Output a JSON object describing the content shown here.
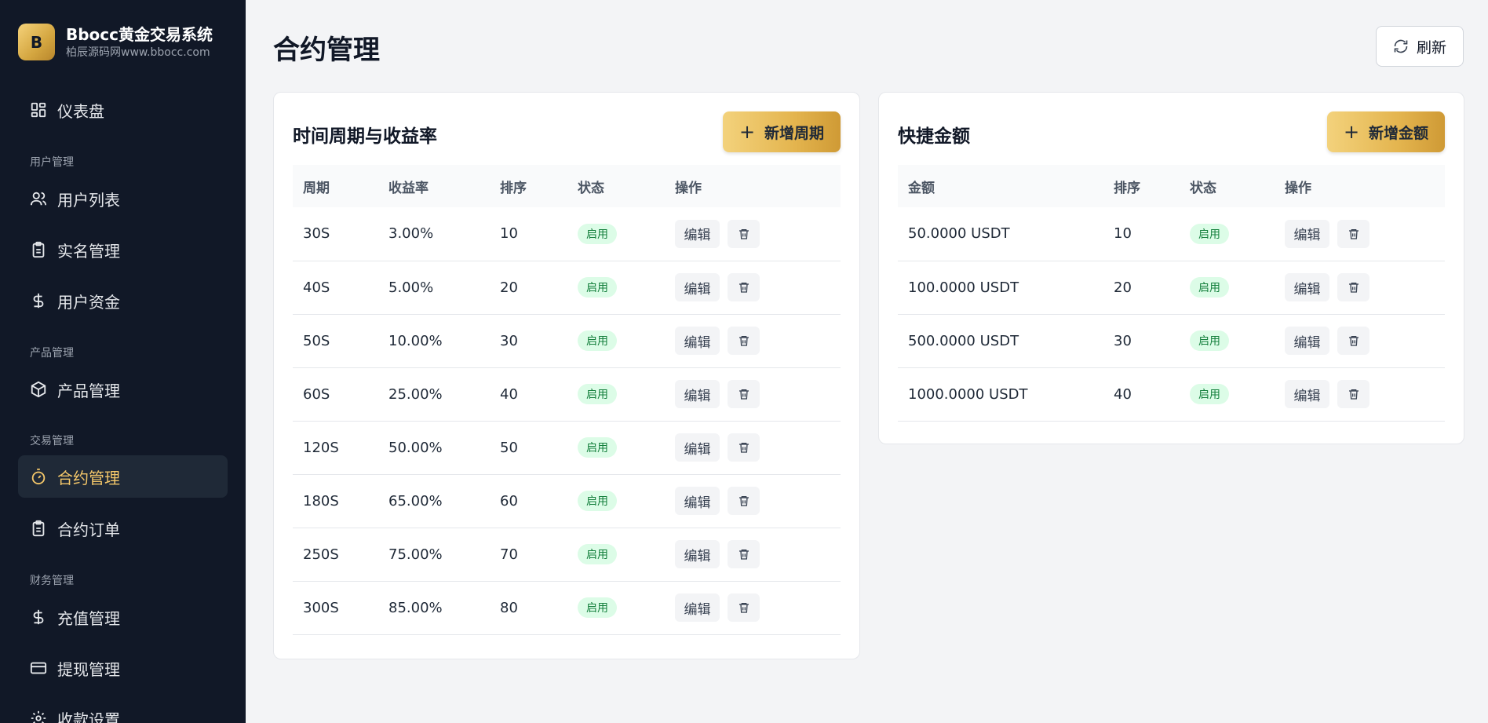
{
  "brand": {
    "logo_letter": "B",
    "title": "Bbocc黄金交易系统",
    "subtitle": "柏辰源码网www.bbocc.com"
  },
  "sidebar": {
    "items": [
      {
        "label": "仪表盘",
        "icon": "dashboard-icon"
      },
      {
        "label": "用户列表",
        "icon": "users-icon"
      },
      {
        "label": "实名管理",
        "icon": "clipboard-icon"
      },
      {
        "label": "用户资金",
        "icon": "dollar-icon"
      },
      {
        "label": "产品管理",
        "icon": "box-icon"
      },
      {
        "label": "合约管理",
        "icon": "timer-icon",
        "active": true
      },
      {
        "label": "合约订单",
        "icon": "clipboard-icon"
      },
      {
        "label": "充值管理",
        "icon": "dollar-icon"
      },
      {
        "label": "提现管理",
        "icon": "card-icon"
      },
      {
        "label": "收款设置",
        "icon": "gear-icon"
      }
    ],
    "sections": [
      "用户管理",
      "产品管理",
      "交易管理",
      "财务管理"
    ]
  },
  "header": {
    "title": "合约管理",
    "refresh_label": "刷新"
  },
  "periods": {
    "title": "时间周期与收益率",
    "add_label": "新增周期",
    "columns": [
      "周期",
      "收益率",
      "排序",
      "状态",
      "操作"
    ],
    "rows": [
      {
        "period": "30S",
        "rate": "3.00%",
        "sort": "10",
        "status": "启用"
      },
      {
        "period": "40S",
        "rate": "5.00%",
        "sort": "20",
        "status": "启用"
      },
      {
        "period": "50S",
        "rate": "10.00%",
        "sort": "30",
        "status": "启用"
      },
      {
        "period": "60S",
        "rate": "25.00%",
        "sort": "40",
        "status": "启用"
      },
      {
        "period": "120S",
        "rate": "50.00%",
        "sort": "50",
        "status": "启用"
      },
      {
        "period": "180S",
        "rate": "65.00%",
        "sort": "60",
        "status": "启用"
      },
      {
        "period": "250S",
        "rate": "75.00%",
        "sort": "70",
        "status": "启用"
      },
      {
        "period": "300S",
        "rate": "85.00%",
        "sort": "80",
        "status": "启用"
      }
    ]
  },
  "amounts": {
    "title": "快捷金额",
    "add_label": "新增金额",
    "columns": [
      "金额",
      "排序",
      "状态",
      "操作"
    ],
    "rows": [
      {
        "amount": "50.0000 USDT",
        "sort": "10",
        "status": "启用"
      },
      {
        "amount": "100.0000 USDT",
        "sort": "20",
        "status": "启用"
      },
      {
        "amount": "500.0000 USDT",
        "sort": "30",
        "status": "启用"
      },
      {
        "amount": "1000.0000 USDT",
        "sort": "40",
        "status": "启用"
      }
    ]
  },
  "actions": {
    "edit_label": "编辑"
  },
  "colors": {
    "sidebar_bg": "#111827",
    "accent_gold": "#e4b54f",
    "active_text": "#f5c86a",
    "status_green": "#15803d"
  }
}
